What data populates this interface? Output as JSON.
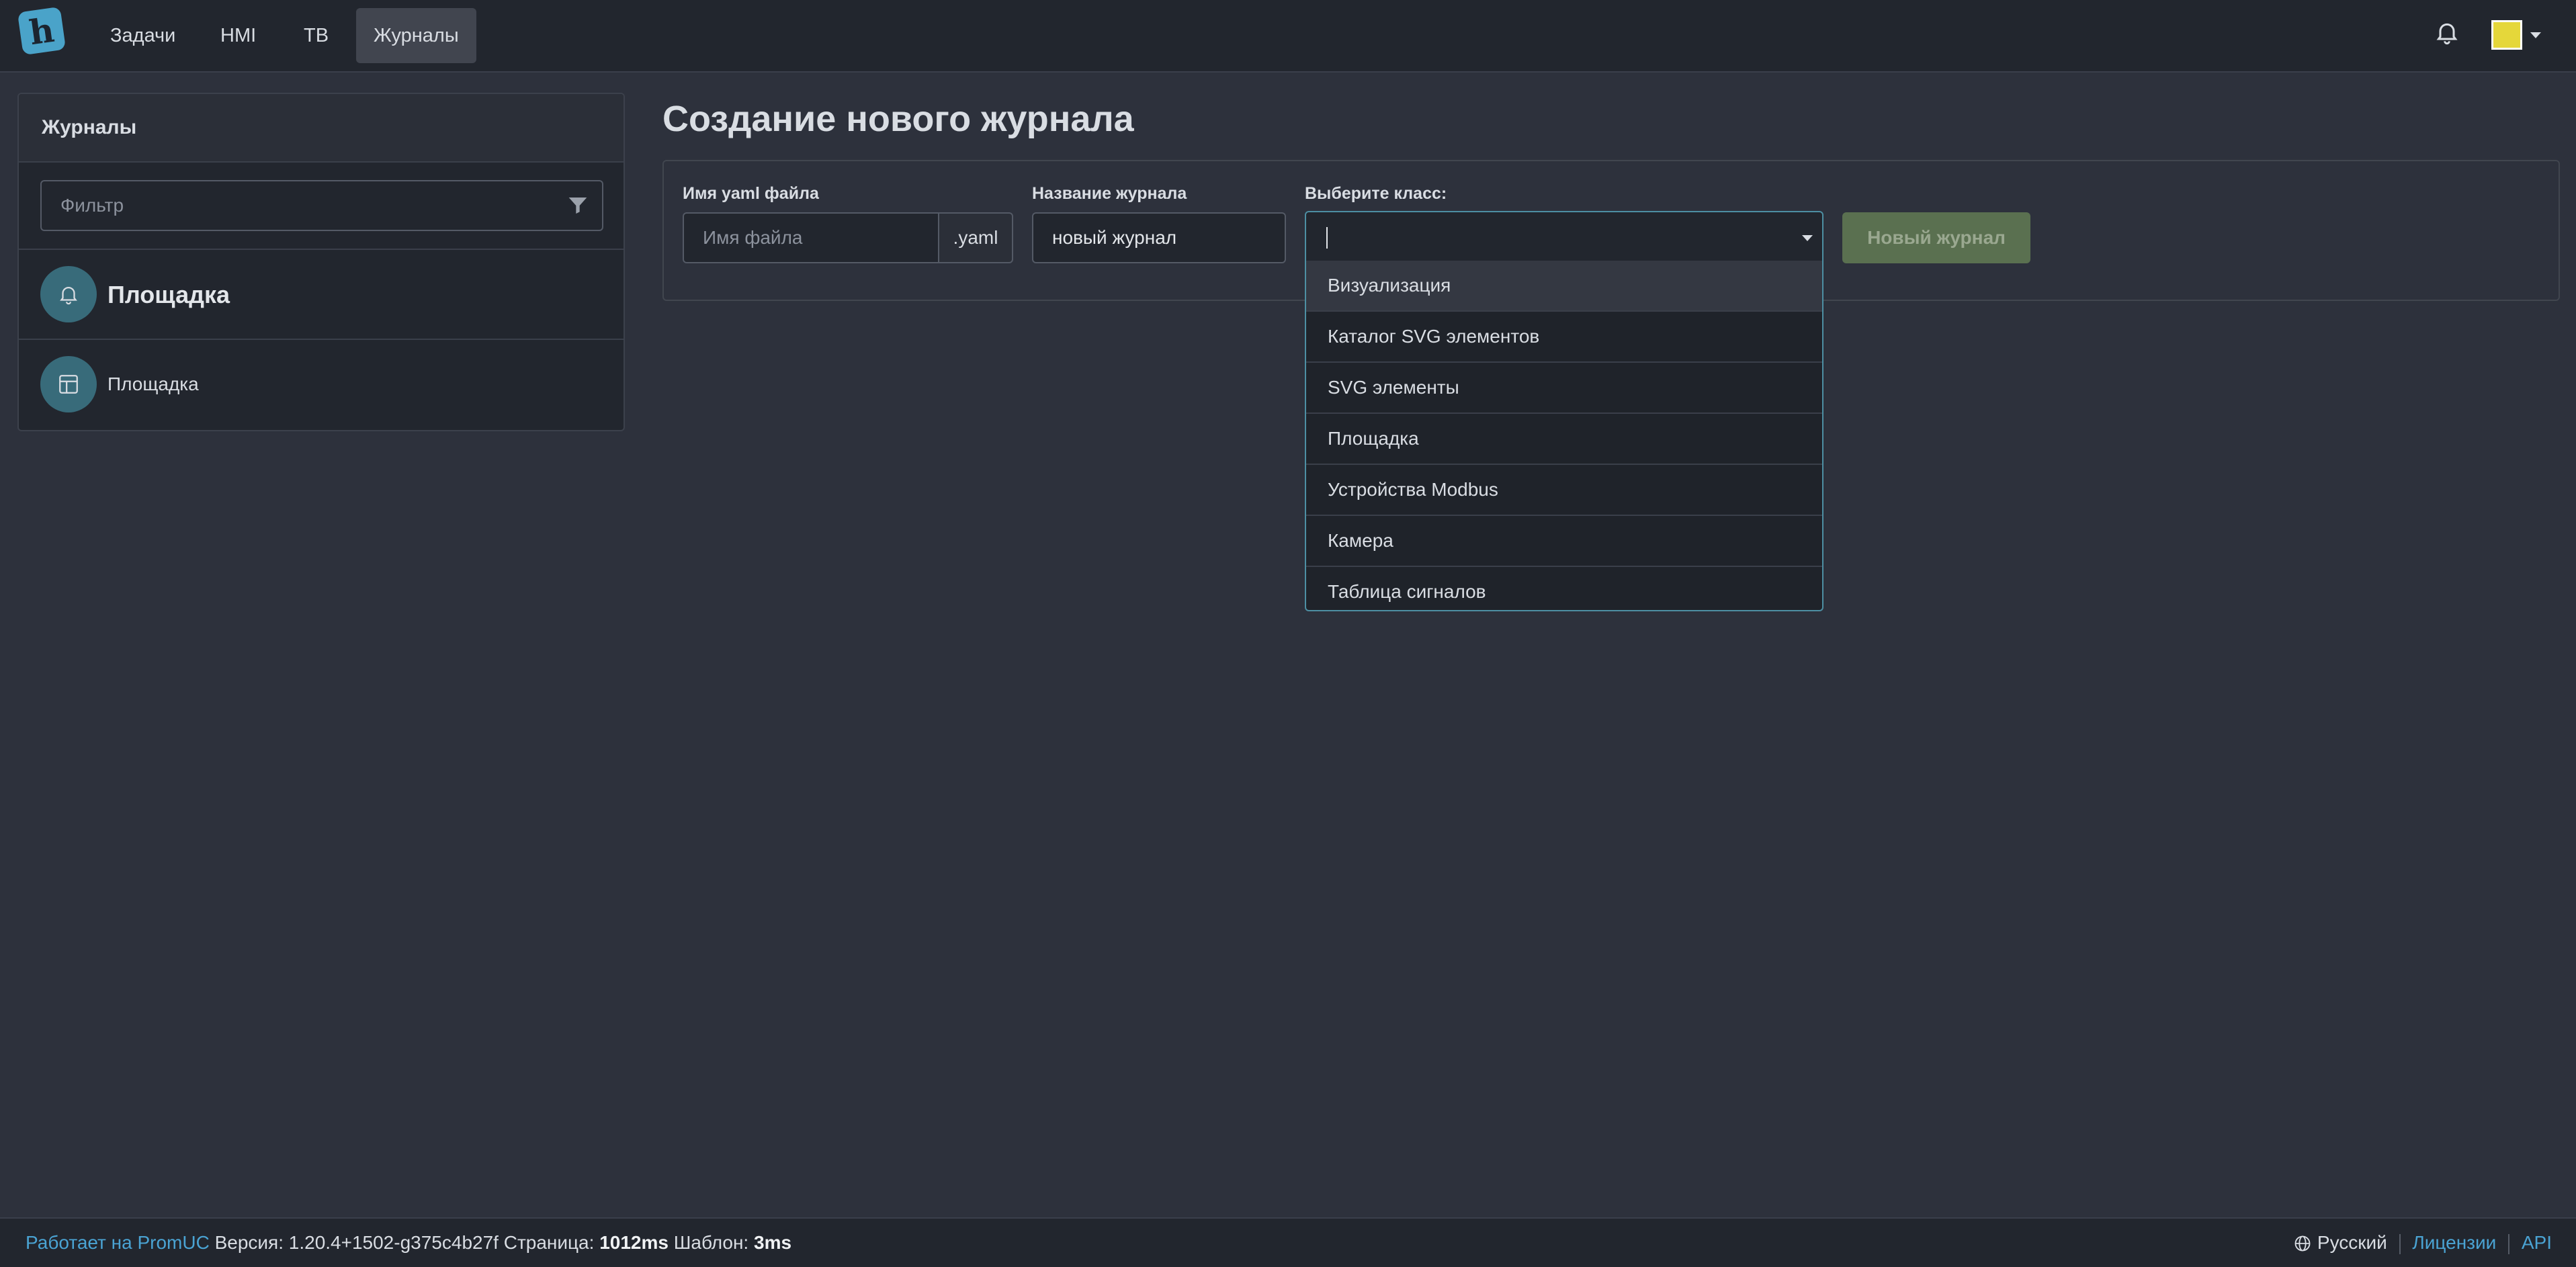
{
  "nav": {
    "logo_letter": "h",
    "items": [
      "Задачи",
      "HMI",
      "ТВ",
      "Журналы"
    ],
    "active_index": 3
  },
  "sidebar": {
    "title": "Журналы",
    "filter_placeholder": "Фильтр",
    "group": {
      "title": "Площадка",
      "icon": "bell-icon"
    },
    "items": [
      {
        "label": "Площадка",
        "icon": "table-icon"
      }
    ]
  },
  "main": {
    "title": "Создание нового журнала",
    "form": {
      "yaml_label": "Имя yaml файла",
      "yaml_placeholder": "Имя файла",
      "yaml_addon": ".yaml",
      "name_label": "Название журнала",
      "name_value": "новый журнал",
      "class_label": "Выберите класс:",
      "class_value": "",
      "class_options": [
        "Визуализация",
        "Каталог SVG элементов",
        "SVG элементы",
        "Площадка",
        "Устройства Modbus",
        "Камера",
        "Таблица сигналов"
      ],
      "submit_label": "Новый журнал"
    }
  },
  "footer": {
    "powered_text": "Работает на PromUC",
    "version_label": "Версия:",
    "version_value": "1.20.4+1502-g375c4b27f",
    "page_label": "Страница:",
    "page_value": "1012ms",
    "template_label": "Шаблон:",
    "template_value": "3ms",
    "language": "Русский",
    "license_link": "Лицензии",
    "api_link": "API"
  },
  "colors": {
    "accent": "#4aa3d3",
    "button_disabled": "#5a7050",
    "background": "#2d313c"
  }
}
